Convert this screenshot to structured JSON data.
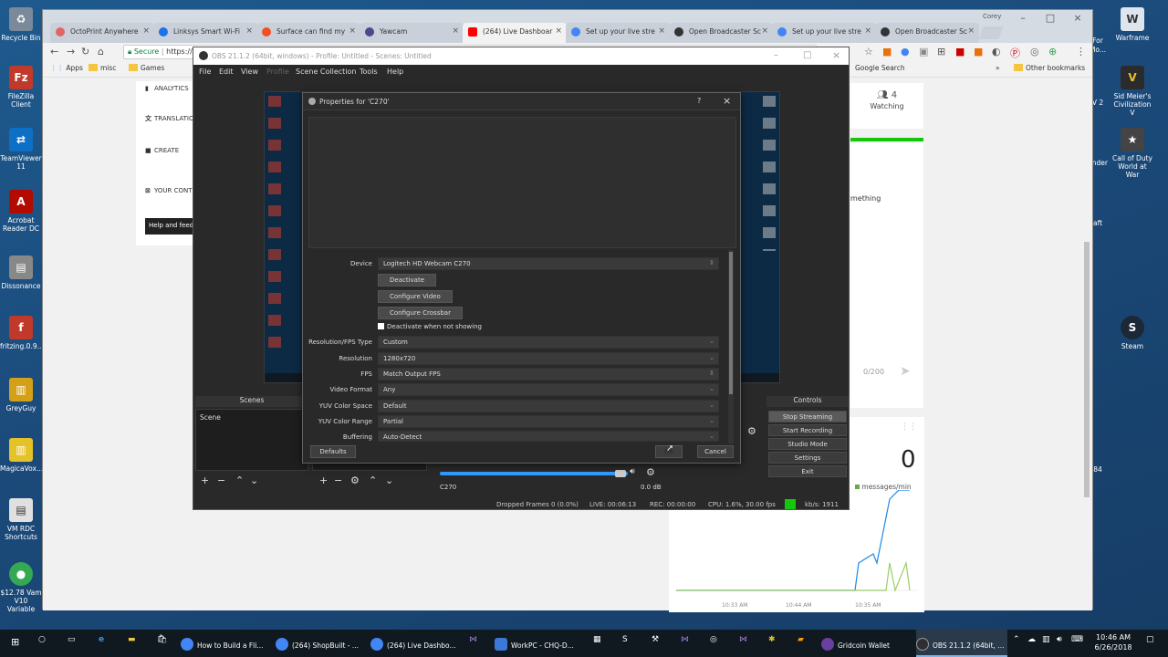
{
  "desktop": {
    "left_icons": [
      {
        "label": "Recycle Bin",
        "color": "#7a8a9a"
      },
      {
        "label": "FileZilla Client",
        "color": "#c0392b"
      },
      {
        "label": "TeamViewer 11",
        "color": "#0e6fc6"
      },
      {
        "label": "Acrobat Reader DC",
        "color": "#b30b00"
      },
      {
        "label": "Dissonance",
        "color": "#888888"
      },
      {
        "label": "fritzing.0.9...",
        "color": "#c0392b"
      },
      {
        "label": "GreyGuy",
        "color": "#d4a017"
      },
      {
        "label": "MagicaVox...",
        "color": "#e6c229"
      },
      {
        "label": "VM RDC Shortcuts",
        "color": "#e0e0e0"
      },
      {
        "label": "$12.78 Vam V10 Variable",
        "color": "#34a853"
      }
    ],
    "right_icons": [
      {
        "label": "Warframe",
        "color": "#dde6ee"
      },
      {
        "label": "Sid Meier's Civilization V",
        "color": "#2b2b2b"
      },
      {
        "label": "Call of Duty World at War",
        "color": "#444444"
      },
      {
        "label": "Steam",
        "color": "#1b2838"
      }
    ],
    "partial_labels": [
      "For",
      "Mo...",
      "V 2",
      "ander",
      "aft",
      "84"
    ]
  },
  "chrome": {
    "tabs": [
      {
        "label": "OctoPrint Anywhere",
        "color": "#e06666"
      },
      {
        "label": "Linksys Smart Wi-Fi",
        "color": "#1a73e8"
      },
      {
        "label": "Surface can find my",
        "color": "#f25022"
      },
      {
        "label": "Yawcam",
        "color": "#4a4a8a"
      },
      {
        "label": "(264) Live Dashboar",
        "color": "#ff0000",
        "active": true
      },
      {
        "label": "Set up your live stre",
        "color": "#4285f4"
      },
      {
        "label": "Open Broadcaster Sc",
        "color": "#333333"
      },
      {
        "label": "Set up your live stre",
        "color": "#4285f4"
      },
      {
        "label": "Open Broadcaster Sc",
        "color": "#333333"
      }
    ],
    "profile": "Corey",
    "address": {
      "secure": "Secure",
      "url": "https://"
    },
    "bookmarks": [
      "Apps",
      "misc",
      "Games"
    ],
    "bookmarks_right": [
      "Google Search",
      "Other bookmarks"
    ],
    "youtube": {
      "nav": [
        "ANALYTICS",
        "TRANSLATIONS & TRANSCRIPTIONS",
        "CREATE",
        "YOUR CONTRIBUTIONS"
      ],
      "help_button": "Help and feedback",
      "watching_count": "4",
      "watching_label": "Watching",
      "chat_text": "mething",
      "chat_counter": "0/200",
      "messages_count": "0",
      "messages_label": "messages/min",
      "chart_times": [
        "10:33 AM",
        "10:44 AM",
        "10:35 AM"
      ]
    }
  },
  "obs": {
    "title": "OBS 21.1.2 (64bit, windows) - Profile: Untitled - Scenes: Untitled",
    "menu": [
      "File",
      "Edit",
      "View",
      "Profile",
      "Scene Collection",
      "Tools",
      "Help"
    ],
    "scenes_header": "Scenes",
    "scene_item": "Scene",
    "controls_header": "Controls",
    "controls": [
      "Stop Streaming",
      "Start Recording",
      "Studio Mode",
      "Settings",
      "Exit"
    ],
    "mixer_source": "C270",
    "mixer_db": "0.0 dB",
    "status": {
      "dropped": "Dropped Frames 0 (0.0%)",
      "live": "LIVE: 00:06:13",
      "rec": "REC: 00:00:00",
      "cpu": "CPU: 1.6%, 30.00 fps",
      "kbps": "kb/s: 1911"
    }
  },
  "properties": {
    "title": "Properties for 'C270'",
    "help": "?",
    "fields": [
      {
        "label": "Device",
        "value": "Logitech HD Webcam C270"
      },
      {
        "label": "Resolution/FPS Type",
        "value": "Custom"
      },
      {
        "label": "Resolution",
        "value": "1280x720"
      },
      {
        "label": "FPS",
        "value": "Match Output FPS"
      },
      {
        "label": "Video Format",
        "value": "Any"
      },
      {
        "label": "YUV Color Space",
        "value": "Default"
      },
      {
        "label": "YUV Color Range",
        "value": "Partial"
      },
      {
        "label": "Buffering",
        "value": "Auto-Detect"
      }
    ],
    "buttons": [
      "Deactivate",
      "Configure Video",
      "Configure Crossbar"
    ],
    "checkbox": {
      "label": "Deactivate when not showing",
      "checked": false
    },
    "defaults": "Defaults",
    "ok": "OK",
    "cancel": "Cancel"
  },
  "taskbar": {
    "apps": [
      {
        "label": "How to Build a Fli...",
        "color": "#4285f4"
      },
      {
        "label": "(264) ShopBuilt - ...",
        "color": "#4285f4"
      },
      {
        "label": "(264) Live Dashbo...",
        "color": "#4285f4"
      },
      {
        "label": "WorkPC - CHQ-D...",
        "color": "#3c78d8"
      },
      {
        "label": "Gridcoin Wallet",
        "color": "#6a3fa0"
      },
      {
        "label": "OBS 21.1.2 (64bit, ...",
        "color": "#302e31",
        "active": true
      }
    ],
    "time": "10:46 AM",
    "date": "6/26/2018"
  }
}
